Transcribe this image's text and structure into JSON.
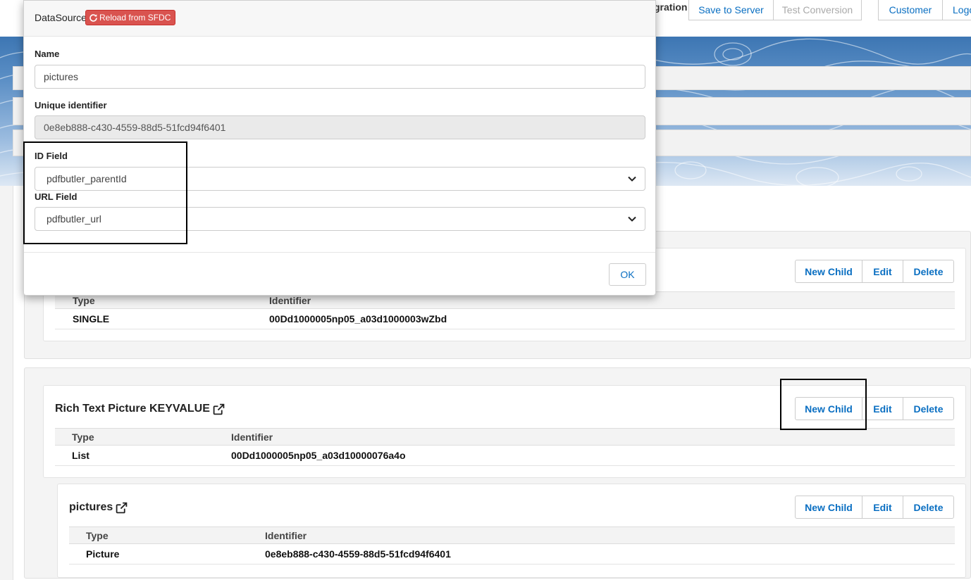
{
  "nav": {
    "fragment": "gration",
    "save_to_server": "Save to Server",
    "test_conversion": "Test Conversion",
    "customer": "Customer",
    "logout": "Logo"
  },
  "modal": {
    "title": "DataSource",
    "reload_label": "Reload from SFDC",
    "name_label": "Name",
    "name_value": "pictures",
    "uid_label": "Unique identifier",
    "uid_value": "0e8eb888-c430-4559-88d5-51fcd94f6401",
    "id_field_label": "ID Field",
    "id_field_value": "pdfbutler_parentId",
    "url_field_label": "URL Field",
    "url_field_value": "pdfbutler_url",
    "ok_label": "OK"
  },
  "buttons": {
    "new_child": "New Child",
    "edit": "Edit",
    "delete": "Delete"
  },
  "table_headers": {
    "type": "Type",
    "identifier": "Identifier"
  },
  "cards": [
    {
      "title": "",
      "type": "SINGLE",
      "identifier": "00Dd1000005np05_a03d1000003wZbd"
    },
    {
      "title": "Rich Text Picture KEYVALUE",
      "type": "List",
      "identifier": "00Dd1000005np05_a03d10000076a4o"
    },
    {
      "title": "pictures",
      "type": "Picture",
      "identifier": "0e8eb888-c430-4559-88d5-51fcd94f6401"
    }
  ],
  "colors": {
    "link_blue": "#0a6fc2",
    "reload_red": "#d9534f",
    "banner_blue": "#3d76b3"
  },
  "icons": {
    "reload": "refresh-icon",
    "external": "external-link-icon",
    "select": "chevron-down-icon"
  }
}
